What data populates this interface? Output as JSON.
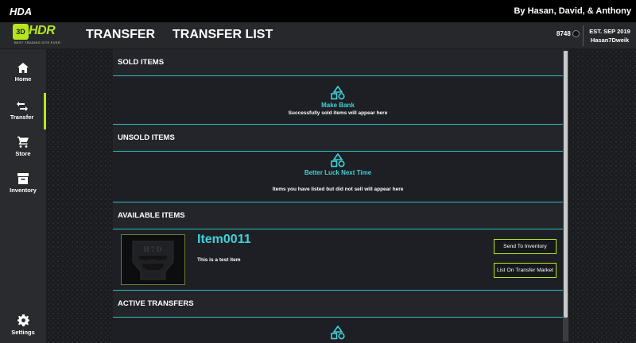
{
  "titlebar": {
    "app_name": "HDA",
    "credits": "By Hasan, David, & Anthony"
  },
  "header": {
    "logo": {
      "mark": "3D",
      "word": "HDR",
      "tagline": "BEST TRADING SITE EVER"
    },
    "titles": [
      "TRANSFER",
      "TRANSFER LIST"
    ],
    "coins": "8748",
    "established": "EST. SEP 2019",
    "username": "Hasan7Dweik"
  },
  "sidebar": {
    "items": [
      {
        "label": "Home",
        "icon": "home-icon"
      },
      {
        "label": "Transfer",
        "icon": "transfer-arrows-icon",
        "active": true
      },
      {
        "label": "Store",
        "icon": "cart-icon"
      },
      {
        "label": "Inventory",
        "icon": "inventory-box-icon"
      },
      {
        "label": "Settings",
        "icon": "gear-icon"
      }
    ]
  },
  "sections": {
    "sold": {
      "heading": "SOLD ITEMS",
      "empty_title": "Make Bank",
      "empty_text": "Successfully sold items will appear here"
    },
    "unsold": {
      "heading": "UNSOLD ITEMS",
      "empty_title": "Better Luck Next Time",
      "empty_text": "Items you have listed but did not sell will appear here"
    },
    "available": {
      "heading": "AVAILABLE ITEMS",
      "items": [
        {
          "name": "Item0011",
          "description": "This is a test item",
          "image_text": "H 7 D"
        }
      ],
      "send_label": "Send To Inventory",
      "list_label": "List On Transfer Market"
    },
    "active": {
      "heading": "ACTIVE TRANSFERS"
    }
  },
  "colors": {
    "accent_lime": "#b5e61d",
    "accent_cyan": "#3fd2d9",
    "divider_teal": "#2bbfbf"
  }
}
